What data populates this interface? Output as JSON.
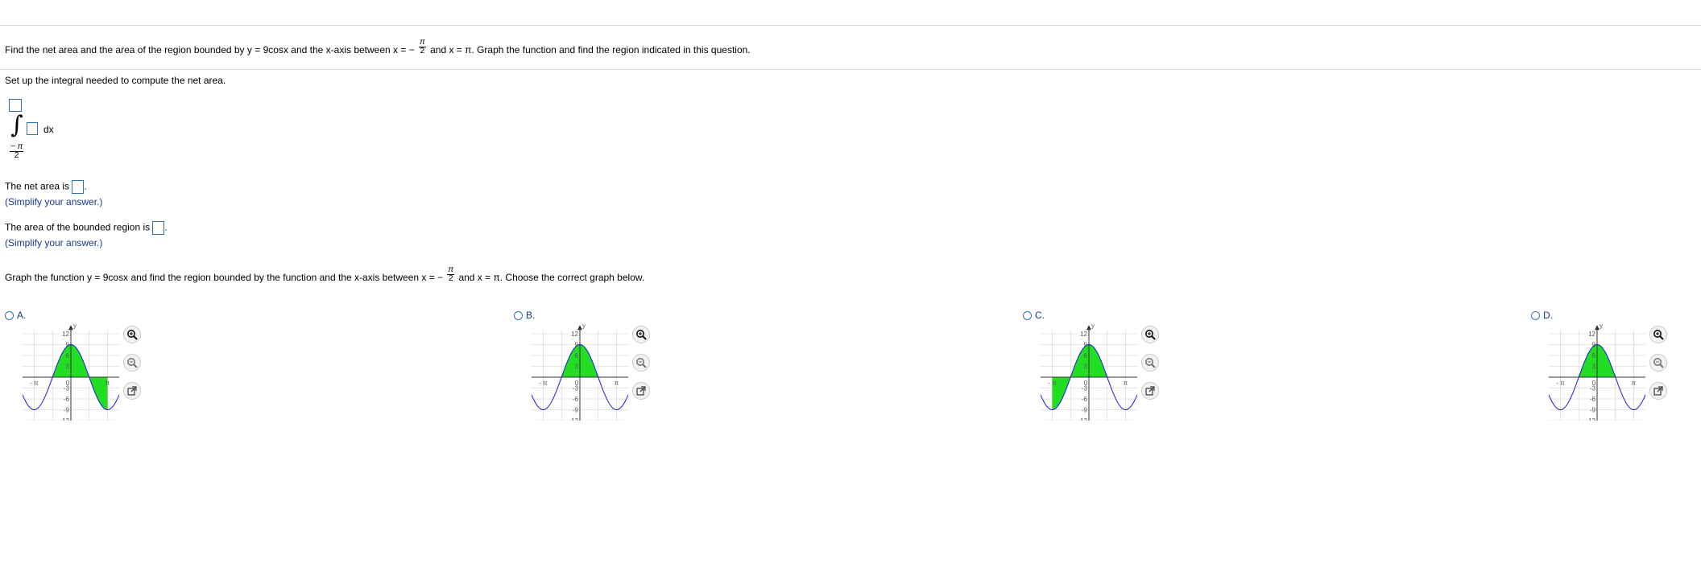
{
  "question": {
    "prompt_before": "Find the net area and the area of the region bounded by y = 9",
    "prompt_func": "cos",
    "prompt_mid": "x and the x-axis between x = −",
    "prompt_frac_num": "π",
    "prompt_frac_den": "2",
    "prompt_after": "and x = π. Graph the function and find the region indicated in this question."
  },
  "setup": {
    "instruction": "Set up the integral needed to compute the net area.",
    "integral_sign": "∫",
    "lower_num": "− π",
    "lower_den": "2",
    "dx_label": "dx"
  },
  "net_area": {
    "label": "The net area is",
    "hint": "(Simplify your answer.)"
  },
  "bounded_area": {
    "label": "The area of the bounded region is",
    "hint": "(Simplify your answer.)"
  },
  "graph_question": {
    "before": "Graph the function y = 9",
    "func": "cos",
    "mid": "x and find the region bounded by the function and the x-axis between x = −",
    "frac_num": "π",
    "frac_den": "2",
    "after": "and x = π. Choose the correct graph below."
  },
  "options": [
    {
      "label": "A.",
      "shade_from": -1.5708,
      "shade_to": 3.1416
    },
    {
      "label": "B.",
      "shade_from": -1.5708,
      "shade_to": 1.5708
    },
    {
      "label": "C.",
      "shade_from": -3.1416,
      "shade_to": 1.5708
    },
    {
      "label": "D.",
      "shade_from": -1.5708,
      "shade_to": 1.5708
    }
  ],
  "graph": {
    "x_label": "x",
    "y_label": "y",
    "y_ticks": [
      "12",
      "9",
      "6",
      "3",
      "-3",
      "-6",
      "-9",
      "-12"
    ],
    "x_ticks": [
      "- 2π",
      "- π",
      "0",
      "π",
      "2π"
    ],
    "curve_color": "#1a1adb",
    "fill_color": "#22dd22"
  },
  "icons": [
    "zoom-in-icon",
    "zoom-out-icon",
    "popout-icon"
  ]
}
